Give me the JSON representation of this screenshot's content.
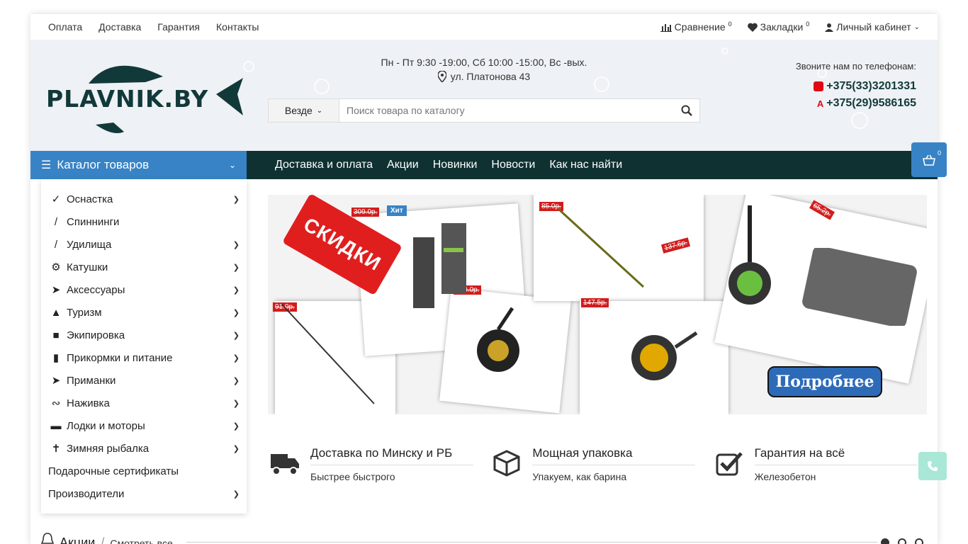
{
  "topbar": {
    "links": [
      "Оплата",
      "Доставка",
      "Гарантия",
      "Контакты"
    ],
    "compare": {
      "label": "Сравнение",
      "count": "0"
    },
    "bookmarks": {
      "label": "Закладки",
      "count": "0"
    },
    "account": {
      "label": "Личный кабинет"
    }
  },
  "header": {
    "logo_text": "PLAVNIK.BY",
    "hours": "Пн - Пт 9:30 -19:00, Сб 10:00 -15:00, Вс -вых.",
    "address": "ул. Платонова 43",
    "phones_label": "Звоните нам по телефонам:",
    "phones": [
      "+375(33)3201331",
      "+375(29)9586165"
    ],
    "operator_colors": [
      "#e30613",
      "#e30613"
    ]
  },
  "search": {
    "scope": "Везде",
    "placeholder": "Поиск товара по каталогу"
  },
  "nav": {
    "catalog_label": "Каталог товаров",
    "links": [
      "Доставка и оплата",
      "Акции",
      "Новинки",
      "Новости",
      "Как нас найти"
    ],
    "cart_count": "0"
  },
  "menu": {
    "items": [
      {
        "label": "Оснастка",
        "icon": "hook-icon",
        "arrow": true
      },
      {
        "label": "Спиннинги",
        "icon": "spinning-rod-icon",
        "arrow": false
      },
      {
        "label": "Удилища",
        "icon": "rod-icon",
        "arrow": true
      },
      {
        "label": "Катушки",
        "icon": "reel-icon",
        "arrow": true
      },
      {
        "label": "Аксессуары",
        "icon": "net-icon",
        "arrow": true
      },
      {
        "label": "Туризм",
        "icon": "tent-icon",
        "arrow": true
      },
      {
        "label": "Экипировка",
        "icon": "jacket-icon",
        "arrow": true
      },
      {
        "label": "Прикормки и питание",
        "icon": "boot-icon",
        "arrow": true
      },
      {
        "label": "Приманки",
        "icon": "lure-icon",
        "arrow": true
      },
      {
        "label": "Наживка",
        "icon": "worm-icon",
        "arrow": true
      },
      {
        "label": "Лодки и моторы",
        "icon": "boat-icon",
        "arrow": true
      },
      {
        "label": "Зимняя рыбалка",
        "icon": "ice-drill-icon",
        "arrow": true
      },
      {
        "label": "Подарочные сертификаты",
        "icon": "",
        "arrow": false
      },
      {
        "label": "Производители",
        "icon": "",
        "arrow": true
      }
    ]
  },
  "banner": {
    "tag_text": "СКИДКИ",
    "hit_label": "Хит",
    "prices": [
      "309.0р.",
      "85.0р.",
      "65.2р.",
      "137.6р.",
      "170.0р.",
      "91.0р.",
      "147.5р."
    ],
    "more_label": "Подробнее"
  },
  "features": [
    {
      "title": "Доставка по Минску и РБ",
      "subtitle": "Быстрее быстрого",
      "icon": "truck-icon"
    },
    {
      "title": "Мощная упаковка",
      "subtitle": "Упакуем, как барина",
      "icon": "box-icon"
    },
    {
      "title": "Гарантия на всё",
      "subtitle": "Железобетон",
      "icon": "checkbox-icon"
    }
  ],
  "promo": {
    "title": "Акции",
    "see_all": "Смотреть все"
  },
  "colors": {
    "nav_bg": "#0f3131",
    "accent": "#3883c5",
    "brand": "#12393a"
  }
}
